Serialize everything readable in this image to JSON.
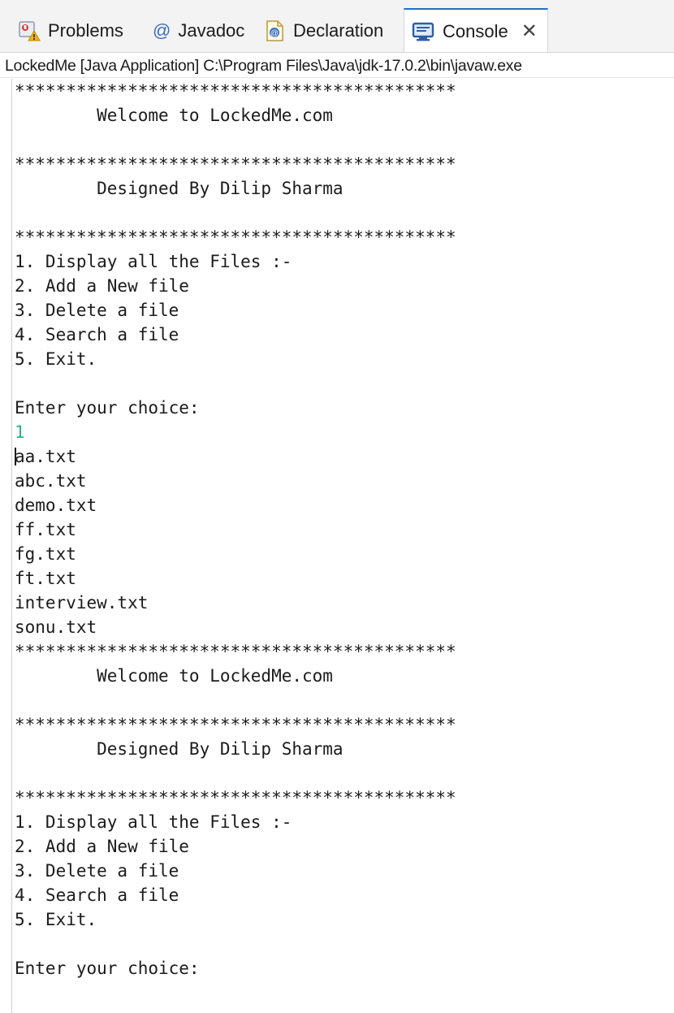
{
  "tabs": [
    {
      "label": "Problems",
      "icon": "problems-icon",
      "active": false
    },
    {
      "label": "Javadoc",
      "icon": "at-icon",
      "active": false
    },
    {
      "label": "Declaration",
      "icon": "declaration-icon",
      "active": false
    },
    {
      "label": "Console",
      "icon": "console-icon",
      "active": true,
      "close": "✕"
    }
  ],
  "launch_label": "LockedMe [Java Application] C:\\Program Files\\Java\\jdk-17.0.2\\bin\\javaw.exe",
  "colors": {
    "input_text": "#21b884",
    "active_tab_accent": "#1a73c8"
  },
  "console_lines": [
    {
      "text": "*******************************************"
    },
    {
      "text": "        Welcome to LockedMe.com"
    },
    {
      "text": ""
    },
    {
      "text": "*******************************************"
    },
    {
      "text": "        Designed By Dilip Sharma"
    },
    {
      "text": ""
    },
    {
      "text": "*******************************************"
    },
    {
      "text": "1. Display all the Files :-"
    },
    {
      "text": "2. Add a New file"
    },
    {
      "text": "3. Delete a file"
    },
    {
      "text": "4. Search a file"
    },
    {
      "text": "5. Exit."
    },
    {
      "text": ""
    },
    {
      "text": "Enter your choice:"
    },
    {
      "text": "1",
      "type": "input"
    },
    {
      "text": "aa.txt",
      "caret": true
    },
    {
      "text": "abc.txt"
    },
    {
      "text": "demo.txt"
    },
    {
      "text": "ff.txt"
    },
    {
      "text": "fg.txt"
    },
    {
      "text": "ft.txt"
    },
    {
      "text": "interview.txt"
    },
    {
      "text": "sonu.txt"
    },
    {
      "text": "*******************************************"
    },
    {
      "text": "        Welcome to LockedMe.com"
    },
    {
      "text": ""
    },
    {
      "text": "*******************************************"
    },
    {
      "text": "        Designed By Dilip Sharma"
    },
    {
      "text": ""
    },
    {
      "text": "*******************************************"
    },
    {
      "text": "1. Display all the Files :-"
    },
    {
      "text": "2. Add a New file"
    },
    {
      "text": "3. Delete a file"
    },
    {
      "text": "4. Search a file"
    },
    {
      "text": "5. Exit."
    },
    {
      "text": ""
    },
    {
      "text": "Enter your choice:"
    }
  ]
}
